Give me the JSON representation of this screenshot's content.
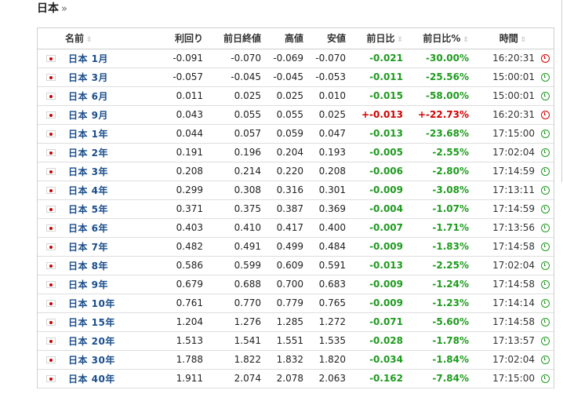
{
  "page": {
    "title": "日本",
    "crumb": "»"
  },
  "table": {
    "headers": {
      "name": "名前",
      "yield": "利回り",
      "prev_close": "前日終値",
      "high": "高値",
      "low": "安値",
      "change": "前日比",
      "change_pct": "前日比%",
      "time": "時間"
    },
    "sort_glyph": "⇳",
    "rows": [
      {
        "name": "日本 1月",
        "yield": "-0.091",
        "prev": "-0.070",
        "high": "-0.069",
        "low": "-0.070",
        "chg": "-0.021",
        "pct": "-30.00%",
        "time": "16:20:31",
        "dir": "neg",
        "state": "closed"
      },
      {
        "name": "日本 3月",
        "yield": "-0.057",
        "prev": "-0.045",
        "high": "-0.045",
        "low": "-0.053",
        "chg": "-0.011",
        "pct": "-25.56%",
        "time": "15:00:01",
        "dir": "neg",
        "state": "open"
      },
      {
        "name": "日本 6月",
        "yield": "0.011",
        "prev": "0.025",
        "high": "0.025",
        "low": "0.010",
        "chg": "-0.015",
        "pct": "-58.00%",
        "time": "15:00:01",
        "dir": "neg",
        "state": "open"
      },
      {
        "name": "日本 9月",
        "yield": "0.043",
        "prev": "0.055",
        "high": "0.055",
        "low": "0.025",
        "chg": "+-0.013",
        "pct": "+-22.73%",
        "time": "16:20:31",
        "dir": "pos",
        "state": "closed"
      },
      {
        "name": "日本 1年",
        "yield": "0.044",
        "prev": "0.057",
        "high": "0.059",
        "low": "0.047",
        "chg": "-0.013",
        "pct": "-23.68%",
        "time": "17:15:00",
        "dir": "neg",
        "state": "open"
      },
      {
        "name": "日本 2年",
        "yield": "0.191",
        "prev": "0.196",
        "high": "0.204",
        "low": "0.193",
        "chg": "-0.005",
        "pct": "-2.55%",
        "time": "17:02:04",
        "dir": "neg",
        "state": "open"
      },
      {
        "name": "日本 3年",
        "yield": "0.208",
        "prev": "0.214",
        "high": "0.220",
        "low": "0.208",
        "chg": "-0.006",
        "pct": "-2.80%",
        "time": "17:14:59",
        "dir": "neg",
        "state": "open"
      },
      {
        "name": "日本 4年",
        "yield": "0.299",
        "prev": "0.308",
        "high": "0.316",
        "low": "0.301",
        "chg": "-0.009",
        "pct": "-3.08%",
        "time": "17:13:11",
        "dir": "neg",
        "state": "open"
      },
      {
        "name": "日本 5年",
        "yield": "0.371",
        "prev": "0.375",
        "high": "0.387",
        "low": "0.369",
        "chg": "-0.004",
        "pct": "-1.07%",
        "time": "17:14:59",
        "dir": "neg",
        "state": "open"
      },
      {
        "name": "日本 6年",
        "yield": "0.403",
        "prev": "0.410",
        "high": "0.417",
        "low": "0.400",
        "chg": "-0.007",
        "pct": "-1.71%",
        "time": "17:13:56",
        "dir": "neg",
        "state": "open"
      },
      {
        "name": "日本 7年",
        "yield": "0.482",
        "prev": "0.491",
        "high": "0.499",
        "low": "0.484",
        "chg": "-0.009",
        "pct": "-1.83%",
        "time": "17:14:58",
        "dir": "neg",
        "state": "open"
      },
      {
        "name": "日本 8年",
        "yield": "0.586",
        "prev": "0.599",
        "high": "0.609",
        "low": "0.591",
        "chg": "-0.013",
        "pct": "-2.25%",
        "time": "17:02:04",
        "dir": "neg",
        "state": "open"
      },
      {
        "name": "日本 9年",
        "yield": "0.679",
        "prev": "0.688",
        "high": "0.700",
        "low": "0.683",
        "chg": "-0.009",
        "pct": "-1.24%",
        "time": "17:14:58",
        "dir": "neg",
        "state": "open"
      },
      {
        "name": "日本 10年",
        "yield": "0.761",
        "prev": "0.770",
        "high": "0.779",
        "low": "0.765",
        "chg": "-0.009",
        "pct": "-1.23%",
        "time": "17:14:14",
        "dir": "neg",
        "state": "open"
      },
      {
        "name": "日本 15年",
        "yield": "1.204",
        "prev": "1.276",
        "high": "1.285",
        "low": "1.272",
        "chg": "-0.071",
        "pct": "-5.60%",
        "time": "17:14:58",
        "dir": "neg",
        "state": "open"
      },
      {
        "name": "日本 20年",
        "yield": "1.513",
        "prev": "1.541",
        "high": "1.551",
        "low": "1.535",
        "chg": "-0.028",
        "pct": "-1.78%",
        "time": "17:13:57",
        "dir": "neg",
        "state": "open"
      },
      {
        "name": "日本 30年",
        "yield": "1.788",
        "prev": "1.822",
        "high": "1.832",
        "low": "1.820",
        "chg": "-0.034",
        "pct": "-1.84%",
        "time": "17:02:04",
        "dir": "neg",
        "state": "open"
      },
      {
        "name": "日本 40年",
        "yield": "1.911",
        "prev": "2.074",
        "high": "2.078",
        "low": "2.063",
        "chg": "-0.162",
        "pct": "-7.84%",
        "time": "17:15:00",
        "dir": "neg",
        "state": "open"
      }
    ]
  },
  "icons": {
    "flag": "japan-flag-icon",
    "open": "clock-open-icon",
    "closed": "clock-closed-icon"
  },
  "colors": {
    "negative": "#1f9b1f",
    "positive": "#d40000",
    "link": "#1a4d8a"
  }
}
